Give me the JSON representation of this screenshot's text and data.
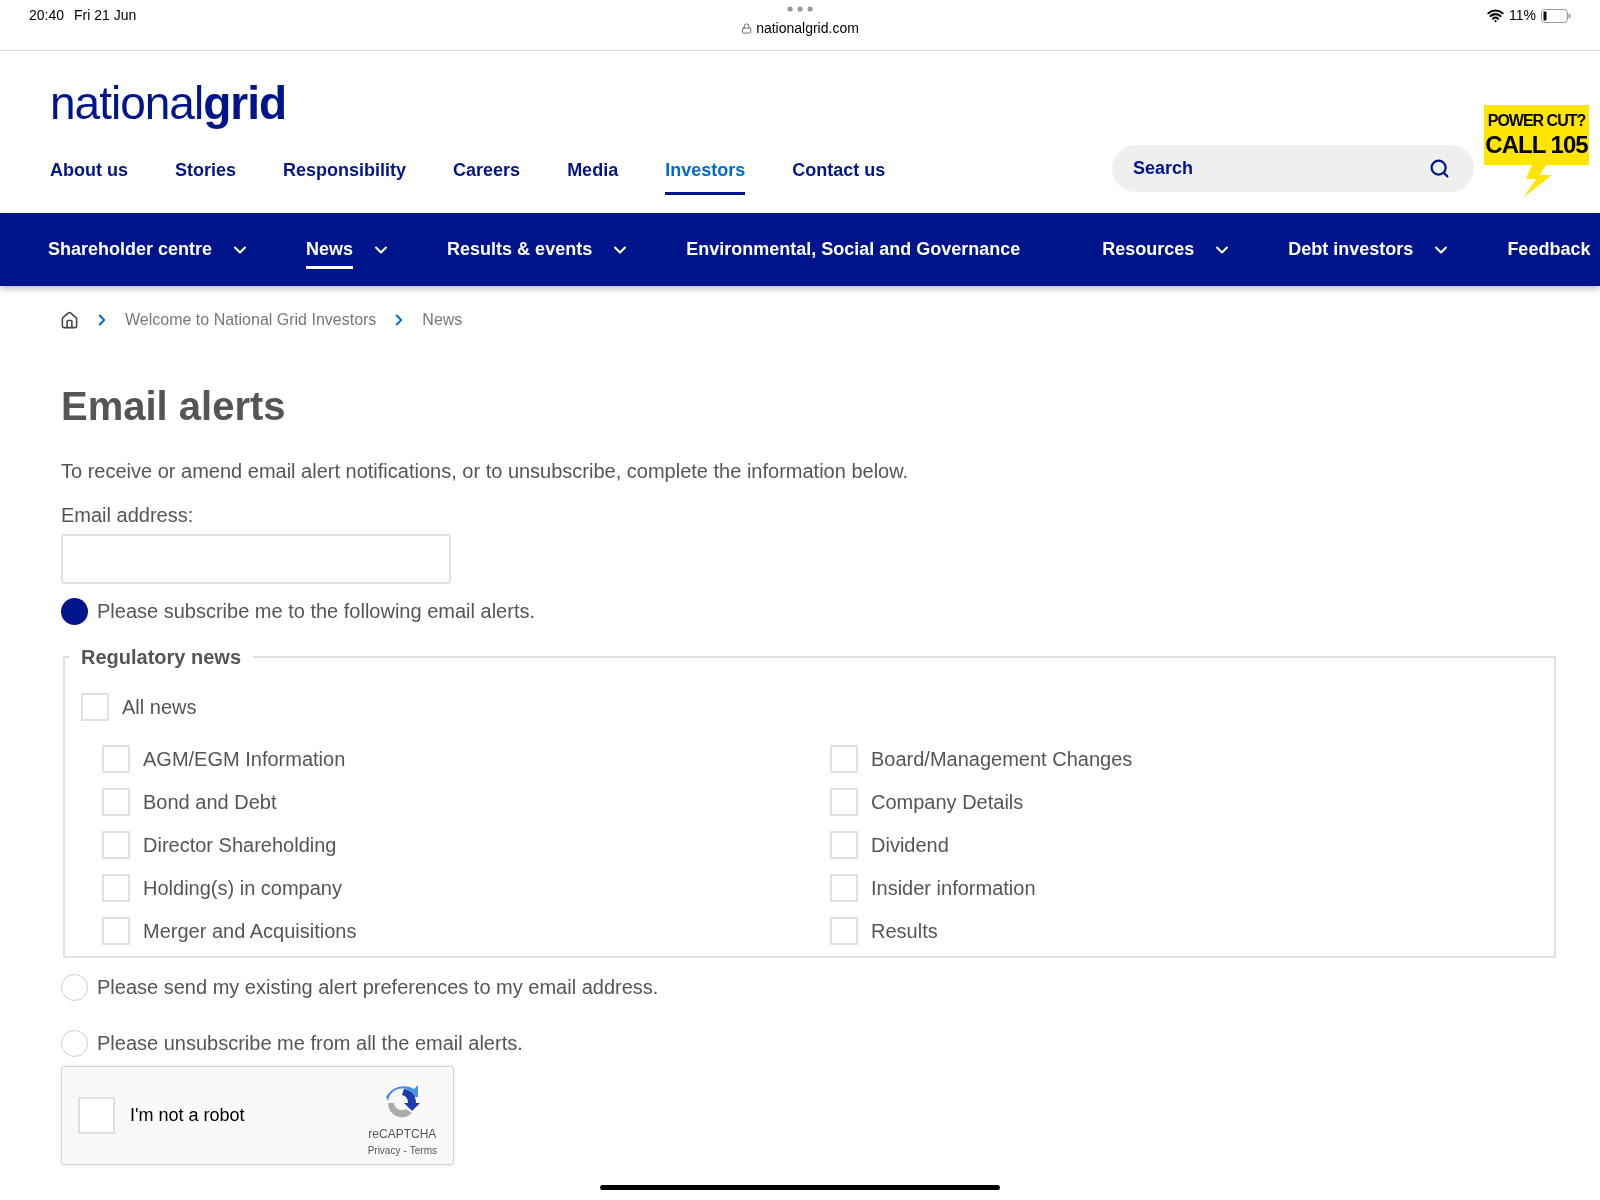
{
  "status_bar": {
    "time": "20:40",
    "date": "Fri 21 Jun",
    "url": "nationalgrid.com",
    "battery": "11%"
  },
  "logo": {
    "light": "national",
    "bold": "grid"
  },
  "top_nav": [
    {
      "label": "About us",
      "selected": false
    },
    {
      "label": "Stories",
      "selected": false
    },
    {
      "label": "Responsibility",
      "selected": false
    },
    {
      "label": "Careers",
      "selected": false
    },
    {
      "label": "Media",
      "selected": false
    },
    {
      "label": "Investors",
      "selected": true
    },
    {
      "label": "Contact us",
      "selected": false
    }
  ],
  "search": {
    "placeholder": "Search"
  },
  "power_cut_badge": {
    "line_1": "POWER CUT?",
    "line_2": "CALL 105"
  },
  "section_nav": [
    {
      "label": "Shareholder centre",
      "dropdown": true,
      "selected": false
    },
    {
      "label": "News",
      "dropdown": true,
      "selected": true
    },
    {
      "label": "Results & events",
      "dropdown": true,
      "selected": false
    },
    {
      "label": "Environmental, Social and Governance",
      "dropdown": false,
      "selected": false
    },
    {
      "label": "Resources",
      "dropdown": true,
      "selected": false
    },
    {
      "label": "Debt investors",
      "dropdown": true,
      "selected": false
    },
    {
      "label": "Feedback",
      "dropdown": false,
      "selected": false
    }
  ],
  "breadcrumb": [
    "Welcome to National Grid Investors",
    "News"
  ],
  "title": "Email alerts",
  "intro": "To receive or amend email alert notifications, or to unsubscribe, complete the information below.",
  "email_label": "Email address:",
  "options": [
    {
      "label": "Please subscribe me to the following email alerts.",
      "selected": true
    },
    {
      "label": "Please send my existing alert preferences to my email address.",
      "selected": false
    },
    {
      "label": "Please unsubscribe me from all the email alerts.",
      "selected": false
    }
  ],
  "regulatory_news": {
    "legend": "Regulatory news",
    "all": {
      "label": "All news",
      "checked": false
    },
    "items": [
      {
        "label": "AGM/EGM Information",
        "checked": false
      },
      {
        "label": "Board/Management Changes",
        "checked": false
      },
      {
        "label": "Bond and Debt",
        "checked": false
      },
      {
        "label": "Company Details",
        "checked": false
      },
      {
        "label": "Director Shareholding",
        "checked": false
      },
      {
        "label": "Dividend",
        "checked": false
      },
      {
        "label": "Holding(s) in company",
        "checked": false
      },
      {
        "label": "Insider information",
        "checked": false
      },
      {
        "label": "Merger and Acquisitions",
        "checked": false
      },
      {
        "label": "Results",
        "checked": false
      }
    ]
  },
  "captcha": {
    "label": "I'm not a robot",
    "checked": false,
    "brand": "reCAPTCHA",
    "privacy": "Privacy",
    "separator": "-",
    "terms": "Terms"
  }
}
